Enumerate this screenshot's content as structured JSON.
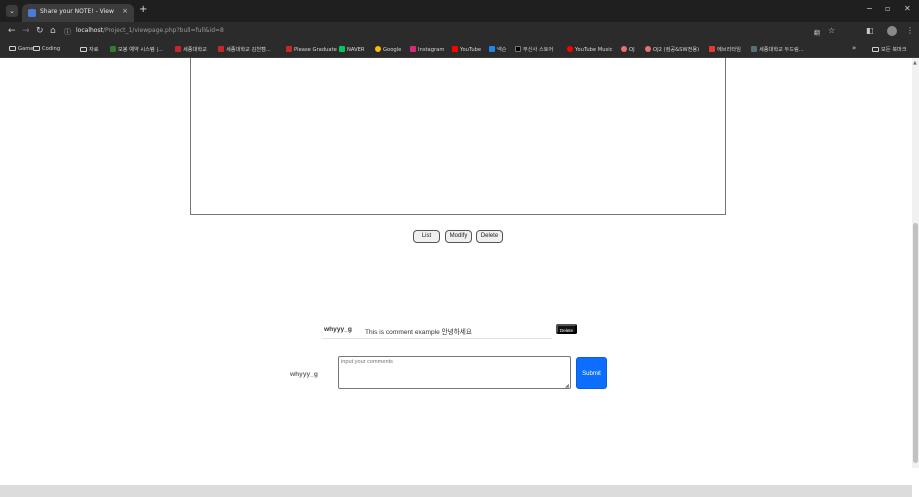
{
  "browser": {
    "tab_title": "Share your NOTE! - View",
    "tab_close": "×",
    "new_tab": "+",
    "url_host": "localhost",
    "url_rest": "/Project_1/viewpage.php?bull=full&id=8",
    "window_controls": [
      "−",
      "▫",
      "✕"
    ]
  },
  "bookmarks": [
    {
      "label": "Game",
      "type": "folder"
    },
    {
      "label": "Coding",
      "type": "folder"
    },
    {
      "label": "자료",
      "type": "folder"
    },
    {
      "label": "모봉 예약 시스템 |...",
      "type": "site",
      "color": "#2e7d32"
    },
    {
      "label": "세종대학교",
      "type": "site",
      "color": "#c62828"
    },
    {
      "label": "세종대학교 김천캠...",
      "type": "site",
      "color": "#c62828"
    },
    {
      "label": "Please Graduate",
      "type": "site",
      "color": "#c62828"
    },
    {
      "label": "NAVER",
      "type": "site",
      "color": "#03c75a"
    },
    {
      "label": "Google",
      "type": "site",
      "color": "#fbbc05"
    },
    {
      "label": "Instagram",
      "type": "site",
      "color": "#d62976"
    },
    {
      "label": "YouTube",
      "type": "site",
      "color": "#ff0000"
    },
    {
      "label": "넥슨",
      "type": "site",
      "color": "#1e88e5"
    },
    {
      "label": "무신사 스토어",
      "type": "site",
      "color": "#000000"
    },
    {
      "label": "YouTube Music",
      "type": "site",
      "color": "#ff0000"
    },
    {
      "label": "OJ",
      "type": "site",
      "color": "#e57373"
    },
    {
      "label": "OJ2 (컴공&SW전용)",
      "type": "site",
      "color": "#e57373"
    },
    {
      "label": "에브리타임",
      "type": "site",
      "color": "#e53935"
    },
    {
      "label": "세종대학교 두드림...",
      "type": "site",
      "color": "#546e7a"
    },
    {
      "label": "모든 북마크",
      "type": "folder"
    }
  ],
  "bookmarks_overflow": "»",
  "view": {
    "buttons": {
      "list": "List",
      "modify": "Modify",
      "delete": "Delete"
    }
  },
  "comments": [
    {
      "author": "whyyy_g",
      "text": "This is comment example 안녕하세요",
      "delete_label": "Delete"
    }
  ],
  "comment_form": {
    "author": "whyyy_g",
    "placeholder": "input your comments",
    "submit_label": "Submit"
  },
  "colors": {
    "submit": "#0d6efd",
    "delete_badge": "#111111"
  }
}
